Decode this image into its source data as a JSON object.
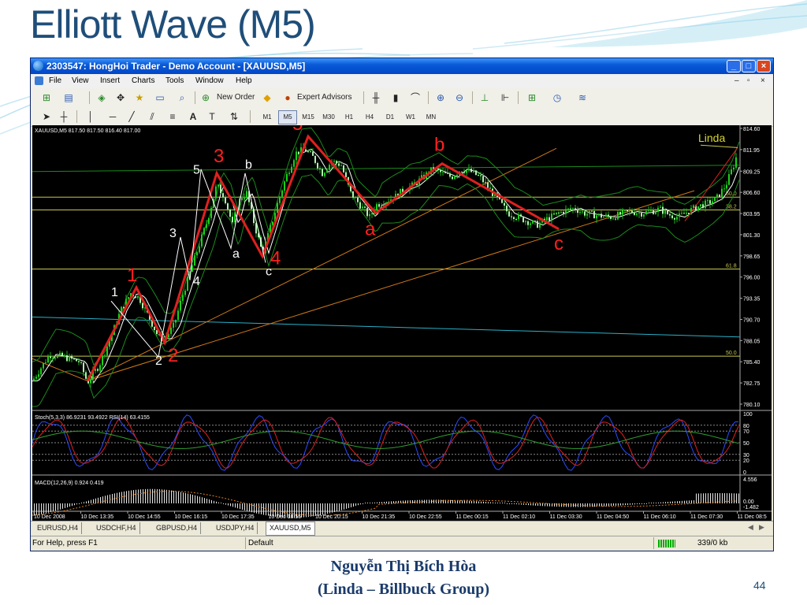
{
  "slide": {
    "title": "Elliott Wave (M5)",
    "author": "Nguyễn Thị Bích Hòa",
    "group": "(Linda – Billbuck Group)",
    "page_number": "44",
    "title_color": "#1f4e79",
    "accent": "#5bc0de"
  },
  "window": {
    "title": "2303547: HongHoi Trader - Demo Account - [XAUUSD,M5]",
    "buttons": [
      "_",
      "□",
      "×"
    ],
    "menu": [
      "File",
      "View",
      "Insert",
      "Charts",
      "Tools",
      "Window",
      "Help"
    ],
    "mdi_buttons": [
      "–",
      "▫",
      "×"
    ]
  },
  "toolbar1": {
    "new_order": "New Order",
    "expert_advisors": "Expert Advisors"
  },
  "toolbar2": {
    "text_tool": "A",
    "timeframes": [
      "M1",
      "M5",
      "M15",
      "M30",
      "H1",
      "H4",
      "D1",
      "W1",
      "MN"
    ],
    "selected": "M5"
  },
  "tabs": {
    "items": [
      "EURUSD,H4",
      "USDCHF,H4",
      "GBPUSD,H4",
      "USDJPY,H4",
      "XAUUSD,M5"
    ],
    "active": "XAUUSD,M5"
  },
  "status": {
    "help": "For Help, press F1",
    "profile": "Default",
    "traffic": "339/0 kb"
  },
  "chart_data": {
    "type": "candlestick",
    "symbol_info": "XAUUSD,M5  817.50 817.50 816.40 817.00",
    "price_axis": [
      "814.60",
      "811.95",
      "809.25",
      "806.60",
      "803.95",
      "801.30",
      "798.65",
      "796.00",
      "793.35",
      "790.70",
      "788.05",
      "785.40",
      "782.75",
      "780.10"
    ],
    "ylim": [
      780.1,
      814.6
    ],
    "time_axis": [
      "10 Dec 2008",
      "10 Dec 13:35",
      "10 Dec 14:55",
      "10 Dec 16:15",
      "10 Dec 17:35",
      "10 Dec 18:55",
      "10 Dec 20:15",
      "10 Dec 21:35",
      "10 Dec 22:55",
      "11 Dec 00:15",
      "11 Dec 02:10",
      "11 Dec 03:30",
      "11 Dec 04:50",
      "11 Dec 06:10",
      "11 Dec 07:30",
      "11 Dec 08:5"
    ],
    "fib_levels": [
      {
        "label": "50.0",
        "price": 806.0
      },
      {
        "label": "38.2",
        "price": 804.4
      },
      {
        "label": "61.8",
        "price": 797.0
      },
      {
        "label": "50.0",
        "price": 786.1
      }
    ],
    "price_path": [
      [
        0,
        783.0
      ],
      [
        12,
        784.8
      ],
      [
        22,
        786.3
      ],
      [
        40,
        786.0
      ],
      [
        60,
        785.4
      ],
      [
        70,
        782.8
      ],
      [
        85,
        785.0
      ],
      [
        100,
        788.5
      ],
      [
        112,
        791.8
      ],
      [
        125,
        794.0
      ],
      [
        135,
        793.5
      ],
      [
        148,
        791.0
      ],
      [
        160,
        788.5
      ],
      [
        168,
        788.2
      ],
      [
        180,
        790.0
      ],
      [
        190,
        793.5
      ],
      [
        200,
        796.5
      ],
      [
        210,
        799.5
      ],
      [
        222,
        803.0
      ],
      [
        234,
        807.5
      ],
      [
        244,
        806.0
      ],
      [
        254,
        802.5
      ],
      [
        262,
        805.5
      ],
      [
        272,
        806.5
      ],
      [
        282,
        802.5
      ],
      [
        292,
        799.0
      ],
      [
        300,
        801.5
      ],
      [
        312,
        805.5
      ],
      [
        322,
        808.5
      ],
      [
        334,
        811.5
      ],
      [
        346,
        812.0
      ],
      [
        356,
        811.0
      ],
      [
        368,
        809.0
      ],
      [
        380,
        810.5
      ],
      [
        392,
        810.0
      ],
      [
        404,
        806.5
      ],
      [
        416,
        805.0
      ],
      [
        428,
        803.5
      ],
      [
        436,
        805.0
      ],
      [
        448,
        805.5
      ],
      [
        460,
        806.0
      ],
      [
        472,
        807.0
      ],
      [
        484,
        807.5
      ],
      [
        496,
        808.5
      ],
      [
        508,
        809.5
      ],
      [
        520,
        809.0
      ],
      [
        532,
        808.5
      ],
      [
        544,
        809.5
      ],
      [
        556,
        809.2
      ],
      [
        568,
        808.5
      ],
      [
        580,
        807.0
      ],
      [
        592,
        805.5
      ],
      [
        604,
        804.0
      ],
      [
        616,
        803.5
      ],
      [
        628,
        803.0
      ],
      [
        640,
        802.5
      ],
      [
        652,
        803.2
      ],
      [
        664,
        803.8
      ],
      [
        676,
        804.3
      ],
      [
        688,
        804.6
      ],
      [
        700,
        804.0
      ],
      [
        712,
        803.8
      ],
      [
        724,
        803.6
      ],
      [
        736,
        803.5
      ],
      [
        748,
        803.9
      ],
      [
        760,
        804.2
      ],
      [
        772,
        804.0
      ],
      [
        784,
        804.2
      ],
      [
        796,
        804.5
      ],
      [
        808,
        803.8
      ],
      [
        820,
        803.5
      ],
      [
        832,
        804.2
      ],
      [
        844,
        804.8
      ],
      [
        856,
        805.2
      ],
      [
        868,
        805.8
      ],
      [
        880,
        807.5
      ],
      [
        890,
        810.0
      ],
      [
        898,
        812.5
      ]
    ],
    "wave_points": [
      {
        "label": "1",
        "style": "red",
        "x": 132,
        "price": 794.7
      },
      {
        "label": "2",
        "style": "red",
        "x": 168,
        "price": 787.8
      },
      {
        "label": "3",
        "style": "red",
        "x": 234,
        "price": 809.0
      },
      {
        "label": "4",
        "style": "red",
        "x": 292,
        "price": 798.6
      },
      {
        "label": "5",
        "style": "red",
        "x": 350,
        "price": 813.6
      },
      {
        "label": "a",
        "style": "red",
        "x": 436,
        "price": 804.0
      },
      {
        "label": "b",
        "style": "red",
        "x": 520,
        "price": 810.2
      },
      {
        "label": "c",
        "style": "red",
        "x": 668,
        "price": 802.0
      },
      {
        "label": "1",
        "style": "white",
        "x": 100,
        "price": 793.0
      },
      {
        "label": "2",
        "style": "white",
        "x": 160,
        "price": 786.0
      },
      {
        "label": "3",
        "style": "white",
        "x": 188,
        "price": 801.0
      },
      {
        "label": "4",
        "style": "white",
        "x": 200,
        "price": 795.6
      },
      {
        "label": "5",
        "style": "white",
        "x": 214,
        "price": 809.5
      },
      {
        "label": "a",
        "style": "white",
        "x": 252,
        "price": 799.6
      },
      {
        "label": "b",
        "style": "white",
        "x": 270,
        "price": 809.0
      },
      {
        "label": "c",
        "style": "white",
        "x": 296,
        "price": 797.8
      }
    ],
    "linda_label": "Linda",
    "indicators": {
      "stoch_label": "Stoch(5,3,3) 86.9231 93.4922  RSI(14) 63.4155",
      "stoch_axis": [
        "100",
        "80",
        "70",
        "50",
        "30",
        "20",
        "0"
      ],
      "macd_label": "MACD(12,26,9) 0.924 0.419",
      "macd_axis": [
        "4.556",
        "0.00",
        "-1.482"
      ]
    }
  }
}
